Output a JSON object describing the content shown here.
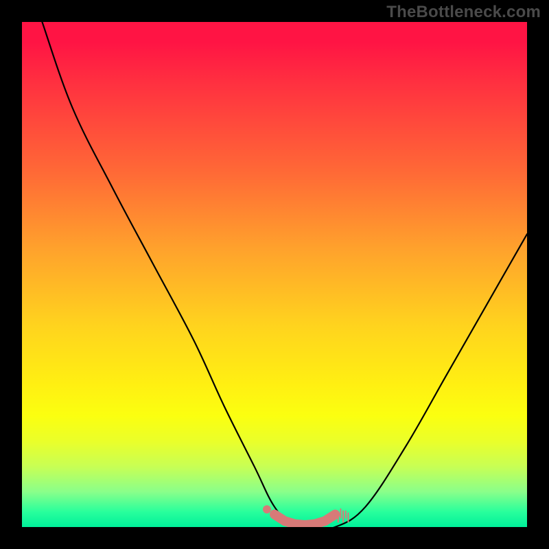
{
  "watermark": "TheBottleneck.com",
  "chart_data": {
    "type": "line",
    "title": "",
    "xlabel": "",
    "ylabel": "",
    "xlim": [
      0,
      100
    ],
    "ylim": [
      0,
      100
    ],
    "series": [
      {
        "name": "bottleneck-curve",
        "x": [
          4,
          10,
          18,
          26,
          34,
          40,
          46,
          50,
          54,
          58,
          62,
          68,
          76,
          84,
          92,
          100
        ],
        "values": [
          100,
          83,
          67,
          52,
          37,
          24,
          12,
          4,
          0,
          0,
          0,
          4,
          16,
          30,
          44,
          58
        ]
      }
    ],
    "marker_band": {
      "name": "optimal-range",
      "x": [
        50,
        52,
        54,
        56,
        58,
        60,
        62
      ],
      "values": [
        2.5,
        1.2,
        0.6,
        0.4,
        0.6,
        1.2,
        2.5
      ]
    },
    "colors": {
      "curve": "#000000",
      "marker": "#d77a78",
      "gradient_top": "#ff1444",
      "gradient_bottom": "#00f09a"
    }
  }
}
